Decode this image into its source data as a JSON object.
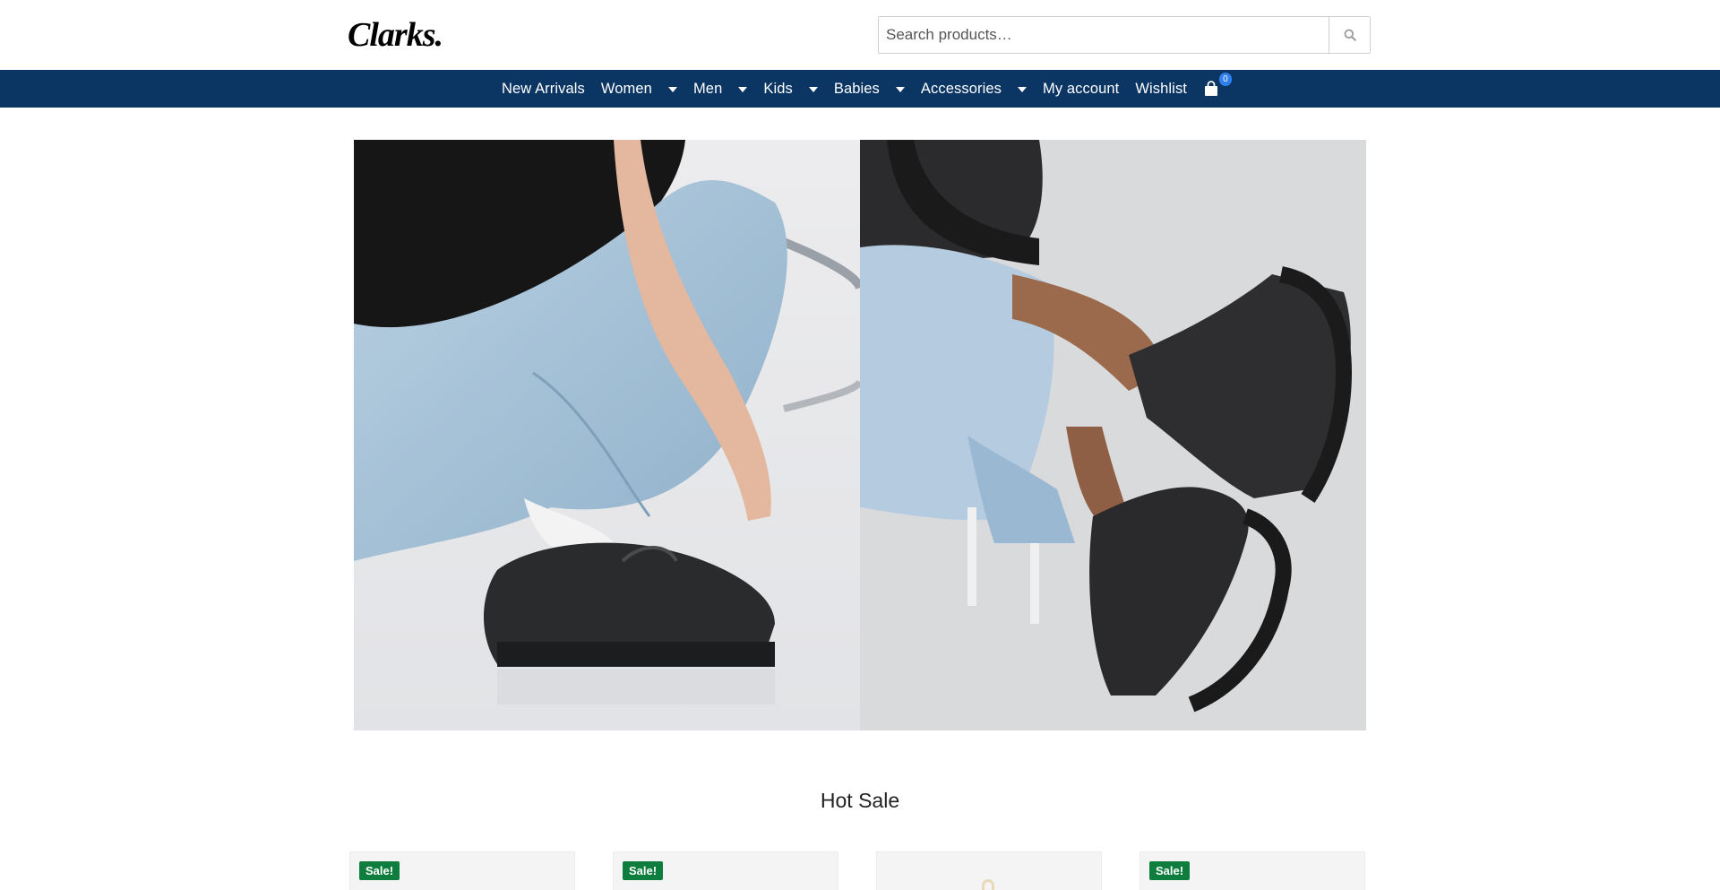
{
  "brand": {
    "logo_text": "Clarks",
    "logo_label": "Clarks logo"
  },
  "search": {
    "placeholder": "Search products…",
    "button_label": "Search"
  },
  "nav": {
    "items": [
      {
        "label": "New Arrivals",
        "has_dropdown": false
      },
      {
        "label": "Women",
        "has_dropdown": true
      },
      {
        "label": "Men",
        "has_dropdown": true
      },
      {
        "label": "Kids",
        "has_dropdown": true
      },
      {
        "label": "Babies",
        "has_dropdown": true
      },
      {
        "label": "Accessories",
        "has_dropdown": true
      },
      {
        "label": "My account",
        "has_dropdown": false
      },
      {
        "label": "Wishlist",
        "has_dropdown": false
      }
    ],
    "cart_count": "0",
    "background_color": "#0b3563"
  },
  "hero": {
    "left_image": "woman-in-jeans-crouching-wearing-black-loafers",
    "right_image": "woman-seated-wearing-black-lace-up-platform-boots"
  },
  "hot_sale": {
    "title": "Hot Sale",
    "products": [
      {
        "badge": "Sale!"
      },
      {
        "badge": "Sale!"
      },
      {
        "badge": ""
      },
      {
        "badge": "Sale!"
      }
    ]
  },
  "colors": {
    "sale_badge": "#0f7d3d",
    "cart_badge": "#2f80ed"
  }
}
